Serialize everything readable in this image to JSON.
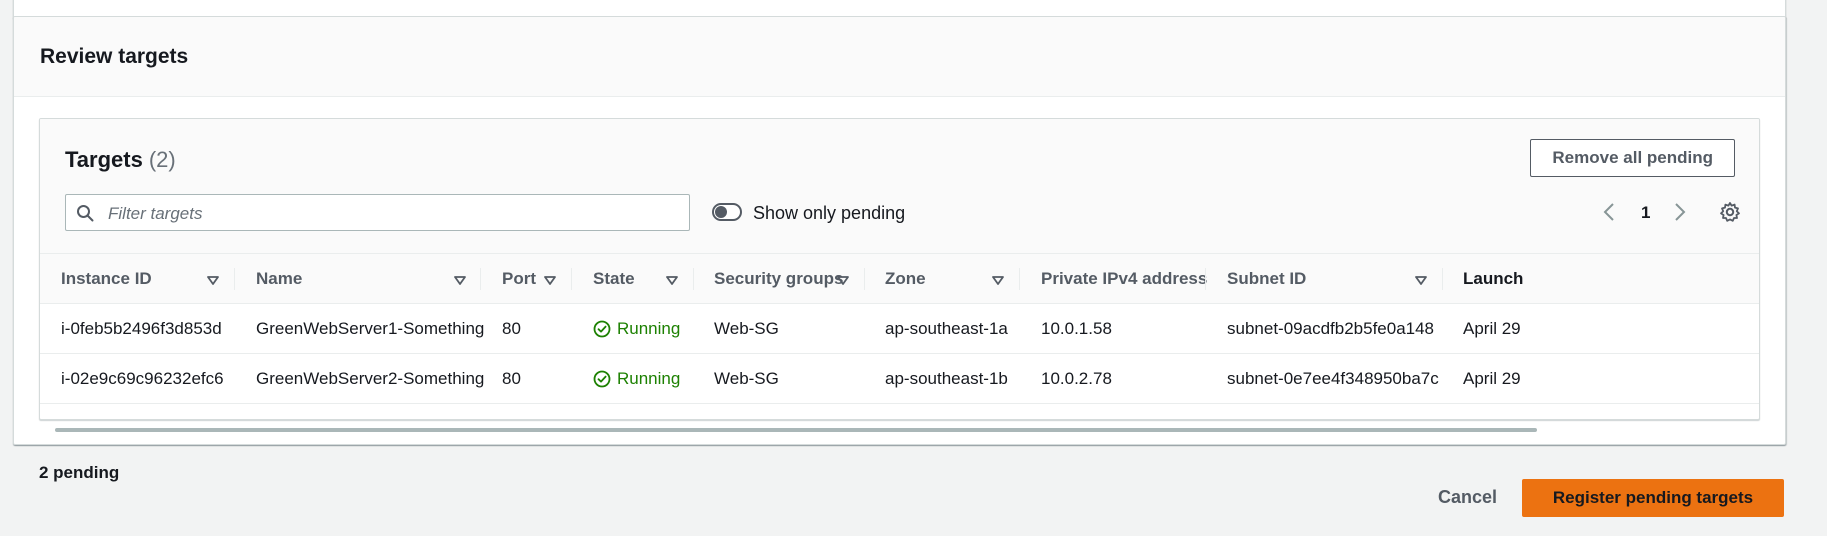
{
  "review": {
    "title": "Review targets"
  },
  "targets": {
    "title": "Targets",
    "count": "(2)",
    "remove_all_label": "Remove all pending",
    "filter_placeholder": "Filter targets",
    "toggle_label": "Show only pending",
    "toggle_on": false,
    "page_number": "1"
  },
  "table": {
    "columns": [
      "Instance ID",
      "Name",
      "Port",
      "State",
      "Security groups",
      "Zone",
      "Private IPv4 address",
      "Subnet ID",
      "Launch"
    ],
    "rows": [
      {
        "instance_id": "i-0feb5b2496f3d853d",
        "name": "GreenWebServer1-Something",
        "port": "80",
        "state": "Running",
        "security_groups": "Web-SG",
        "zone": "ap-southeast-1a",
        "ipv4": "10.0.1.58",
        "subnet": "subnet-09acdfb2b5fe0a148",
        "launch": "April 29"
      },
      {
        "instance_id": "i-02e9c69c96232efc6",
        "name": "GreenWebServer2-Something",
        "port": "80",
        "state": "Running",
        "security_groups": "Web-SG",
        "zone": "ap-southeast-1b",
        "ipv4": "10.0.2.78",
        "subnet": "subnet-0e7ee4f348950ba7c",
        "launch": "April 29"
      }
    ]
  },
  "footer": {
    "pending_text": "2 pending",
    "cancel_label": "Cancel",
    "register_label": "Register pending targets"
  },
  "colors": {
    "primary_button": "#ec7211",
    "running_status": "#1d8102",
    "page_background": "#f2f3f3"
  }
}
